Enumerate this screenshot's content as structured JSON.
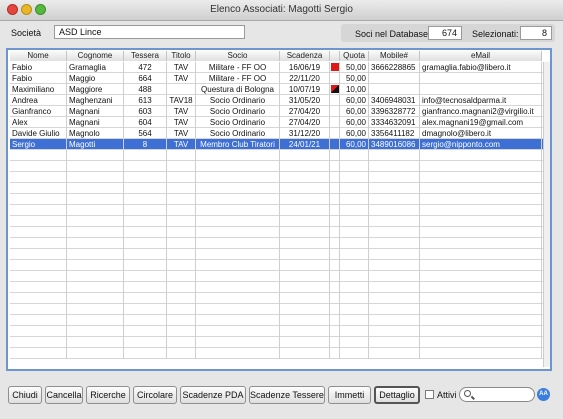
{
  "window": {
    "title": "Elenco Associati: Magotti Sergio"
  },
  "form": {
    "societa_label": "Società",
    "societa_value": "ASD Lince",
    "soci_label": "Soci nel Database:",
    "soci_value": "674",
    "selezionati_label": "Selezionati:",
    "selezionati_value": "8"
  },
  "table": {
    "columns": [
      "Nome",
      "Cognome",
      "Tessera",
      "Titolo",
      "Socio",
      "Scadenza",
      "",
      "Quota",
      "Mobile#",
      "eMail"
    ],
    "rows": [
      {
        "nome": "Fabio",
        "cognome": "Gramaglia",
        "tessera": "472",
        "titolo": "TAV",
        "socio": "Militare - FF OO",
        "scadenza": "16/06/19",
        "flag": "red",
        "quota": "50,00",
        "mobile": "3666228865",
        "email": "gramaglia.fabio@libero.it",
        "selected": false
      },
      {
        "nome": "Fabio",
        "cognome": "Maggio",
        "tessera": "664",
        "titolo": "TAV",
        "socio": "Militare - FF OO",
        "scadenza": "22/11/20",
        "flag": "",
        "quota": "50,00",
        "mobile": "",
        "email": "",
        "selected": false
      },
      {
        "nome": "Maximiliano",
        "cognome": "Maggiore",
        "tessera": "488",
        "titolo": "",
        "socio": "Questura di Bologna",
        "scadenza": "10/07/19",
        "flag": "half",
        "quota": "10,00",
        "mobile": "",
        "email": "",
        "selected": false
      },
      {
        "nome": "Andrea",
        "cognome": "Maghenzani",
        "tessera": "613",
        "titolo": "TAV18",
        "socio": "Socio Ordinario",
        "scadenza": "31/05/20",
        "flag": "",
        "quota": "60,00",
        "mobile": "3406948031",
        "email": "info@tecnosaldparma.it",
        "selected": false
      },
      {
        "nome": "Gianfranco",
        "cognome": "Magnani",
        "tessera": "603",
        "titolo": "TAV",
        "socio": "Socio Ordinario",
        "scadenza": "27/04/20",
        "flag": "",
        "quota": "60,00",
        "mobile": "3396328772",
        "email": "gianfranco.magnani2@virgilio.it",
        "selected": false
      },
      {
        "nome": "Alex",
        "cognome": "Magnani",
        "tessera": "604",
        "titolo": "TAV",
        "socio": "Socio Ordinario",
        "scadenza": "27/04/20",
        "flag": "",
        "quota": "60,00",
        "mobile": "3334632091",
        "email": "alex.magnani19@gmail.com",
        "selected": false
      },
      {
        "nome": "Davide Giulio",
        "cognome": "Magnolo",
        "tessera": "564",
        "titolo": "TAV",
        "socio": "Socio Ordinario",
        "scadenza": "31/12/20",
        "flag": "",
        "quota": "60,00",
        "mobile": "3356411182",
        "email": "dmagnolo@libero.it",
        "selected": false
      },
      {
        "nome": "Sergio",
        "cognome": "Magotti",
        "tessera": "8",
        "titolo": "TAV",
        "socio": "Membro Club Tiratori",
        "scadenza": "24/01/21",
        "flag": "",
        "quota": "60,00",
        "mobile": "3489016086",
        "email": "sergio@nipponto.com",
        "selected": true
      }
    ]
  },
  "toolbar": {
    "buttons": [
      "Chiudi",
      "Cancella",
      "Ricerche",
      "Circolare",
      "Scadenze PDA",
      "Scadenze Tessere",
      "Immetti",
      "Dettaglio"
    ],
    "attivi_label": "Attivi",
    "search_value": ""
  },
  "colors": {
    "selection": "#3d6fd4",
    "flag_red": "#e01818",
    "grid_border": "#6f95cf"
  }
}
